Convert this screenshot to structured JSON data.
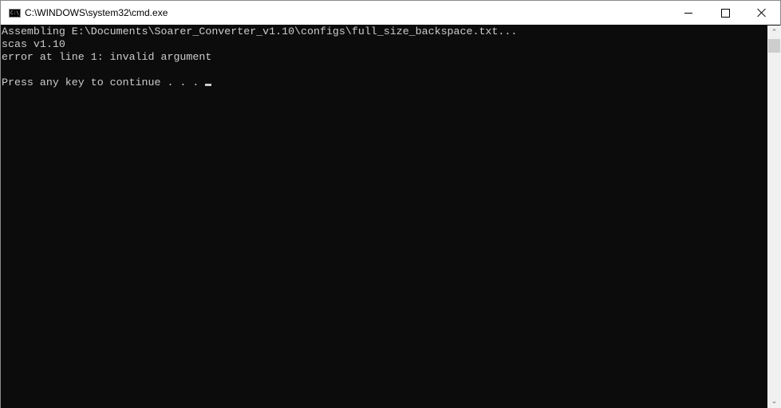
{
  "window": {
    "title": "C:\\WINDOWS\\system32\\cmd.exe",
    "icon": "cmd-icon",
    "icon_text": "C:\\_",
    "controls": {
      "minimize": "minimize-icon",
      "maximize": "maximize-icon",
      "close": "close-icon"
    }
  },
  "console": {
    "lines": [
      "Assembling E:\\Documents\\Soarer_Converter_v1.10\\configs\\full_size_backspace.txt...",
      "scas v1.10",
      "error at line 1: invalid argument",
      "",
      "Press any key to continue . . . "
    ],
    "colors": {
      "background": "#0c0c0c",
      "foreground": "#cccccc"
    }
  },
  "scrollbar": {
    "up": "chevron-up-icon",
    "down": "chevron-down-icon",
    "up_glyph": "⌃",
    "down_glyph": "⌄"
  }
}
